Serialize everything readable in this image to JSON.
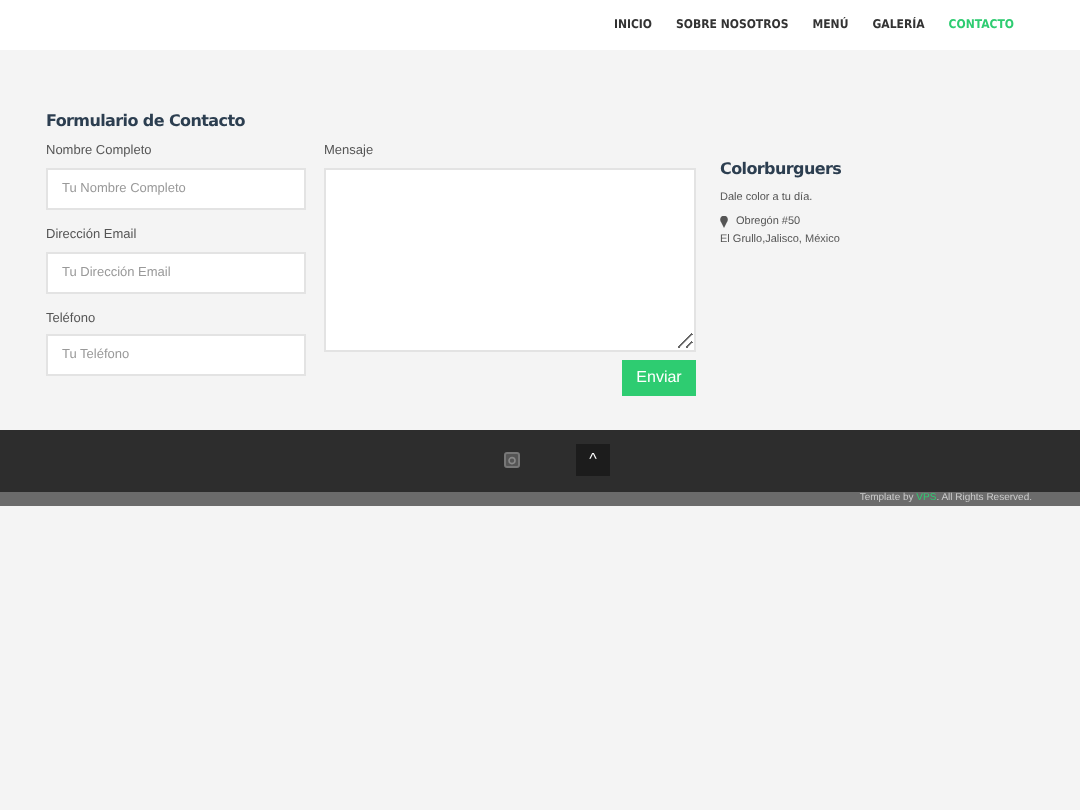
{
  "nav": [
    {
      "label": "INICIO",
      "selected": false
    },
    {
      "label": "SOBRE NOSOTROS",
      "selected": false
    },
    {
      "label": "MENÚ",
      "selected": false
    },
    {
      "label": "GALERÍA",
      "selected": false
    },
    {
      "label": "CONTACTO",
      "selected": true
    }
  ],
  "form": {
    "title": "Formulario de Contacto",
    "fields": [
      {
        "label": "Nombre Completo",
        "placeholder": "Tu Nombre Completo"
      },
      {
        "label": "Dirección Email",
        "placeholder": "Tu Dirección Email"
      },
      {
        "label": "Teléfono",
        "placeholder": "Tu Teléfono"
      }
    ],
    "message": {
      "label": "Mensaje"
    },
    "submit": "Enviar"
  },
  "info": {
    "title": "Colorburguers",
    "tagline": "Dale color a tu día.",
    "address": [
      "Obregón #50",
      "El Grullo,Jalisco, México"
    ]
  },
  "footer": {
    "back_to_top": "^",
    "credit": [
      "Template by ",
      "VPS",
      ". All Rights Reserved."
    ]
  }
}
